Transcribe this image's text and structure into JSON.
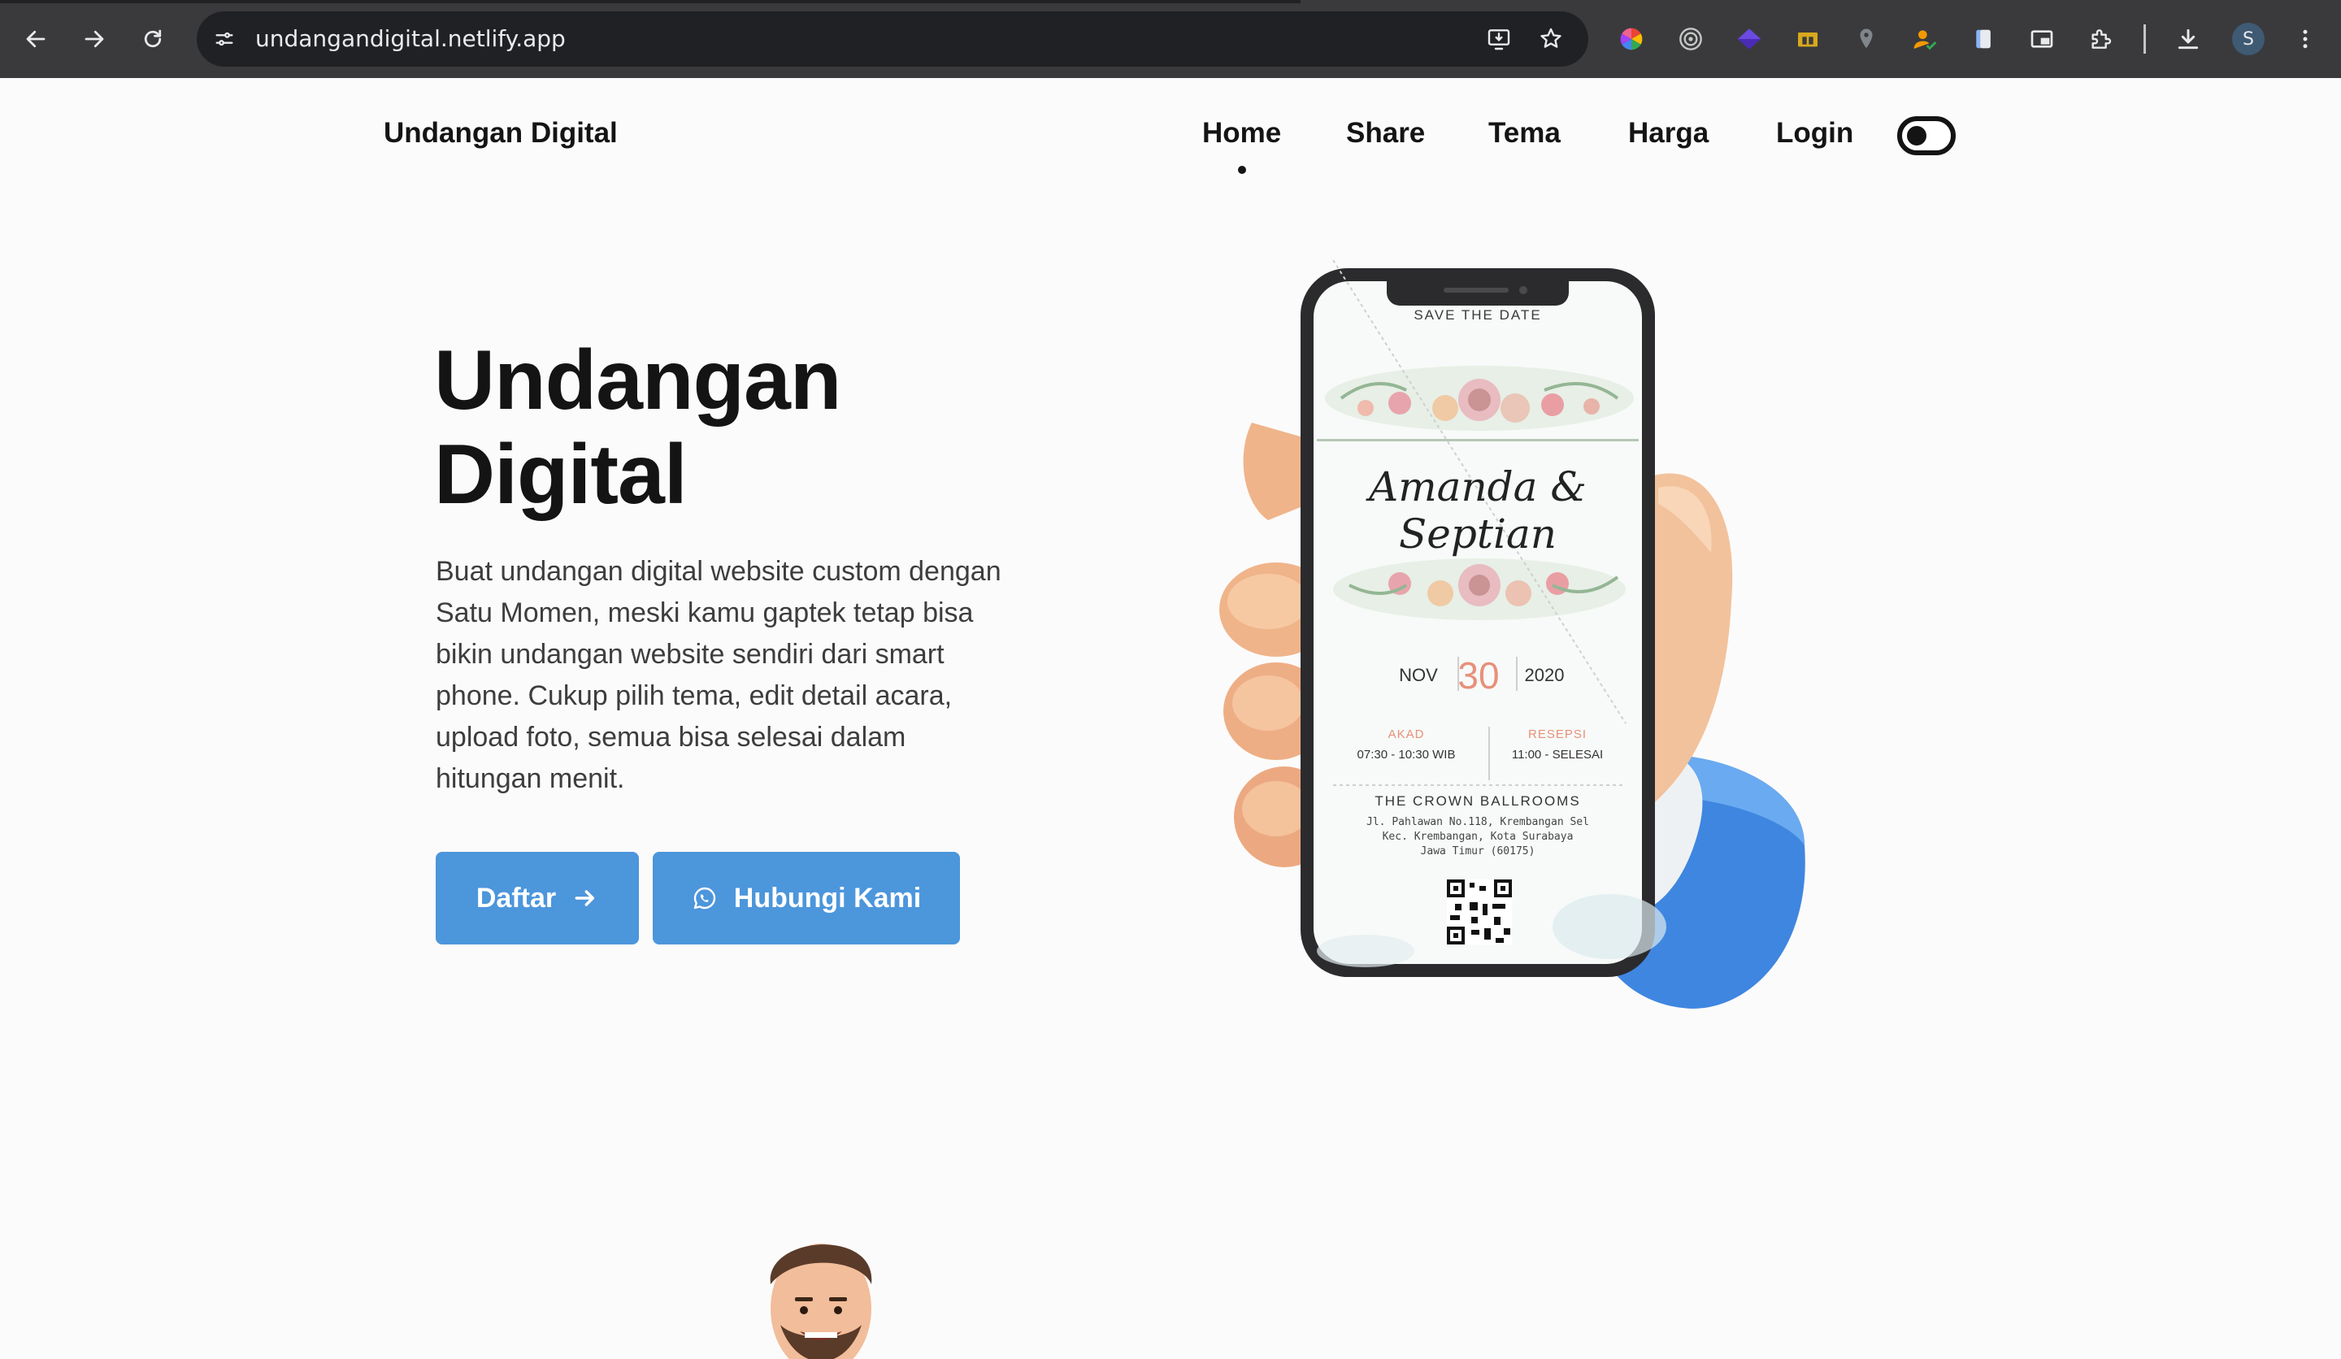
{
  "browser": {
    "url": "undangandigital.netlify.app",
    "profile_initial": "S"
  },
  "nav": {
    "brand": "Undangan Digital",
    "items": [
      {
        "label": "Home",
        "active": true
      },
      {
        "label": "Share"
      },
      {
        "label": "Tema"
      },
      {
        "label": "Harga"
      },
      {
        "label": "Login"
      }
    ],
    "theme_toggle": "dark-mode-toggle"
  },
  "hero": {
    "title_line1": "Undangan",
    "title_line2": "Digital",
    "description": "Buat undangan digital website custom dengan Satu Momen, meski kamu gaptek tetap bisa bikin undangan website sendiri dari smart phone. Cukup pilih tema, edit detail acara, upload foto, semua bisa selesai dalam hitungan menit.",
    "primary_button": "Daftar",
    "secondary_button": "Hubungi Kami"
  },
  "invitation": {
    "save_the_date": "SAVE THE DATE",
    "names": "Amanda & Septian",
    "month": "NOV",
    "day": "30",
    "year": "2020",
    "akad_label": "AKAD",
    "akad_time": "07:30 - 10:30 WIB",
    "resepsi_label": "RESEPSI",
    "resepsi_time": "11:00 - SELESAI",
    "venue": "THE CROWN BALLROOMS",
    "address_line1": "Jl. Pahlawan No.118, Krembangan Sel",
    "address_line2": "Kec. Krembangan, Kota Surabaya",
    "address_line3": "Jawa Timur (60175)"
  },
  "colors": {
    "accent": "#4c96dc",
    "text": "#141414",
    "date_accent": "#e8907a"
  }
}
